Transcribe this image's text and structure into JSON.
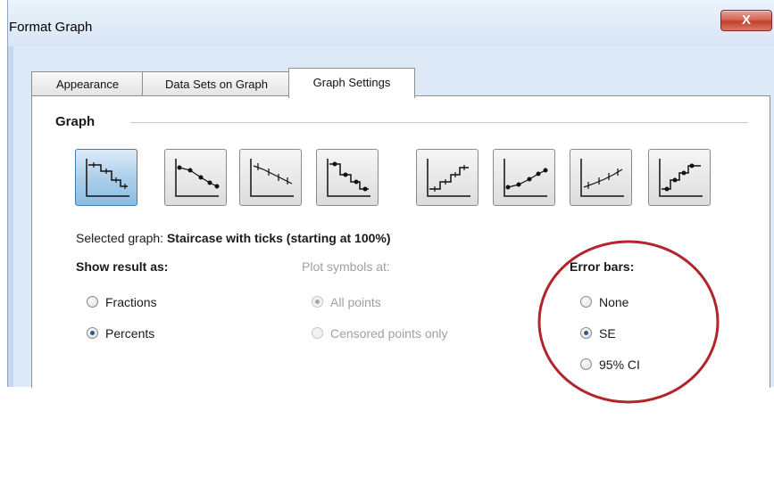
{
  "window": {
    "title": "Format Graph",
    "close_label": "X"
  },
  "tabs": [
    {
      "label": "Appearance",
      "active": false
    },
    {
      "label": "Data Sets on Graph",
      "active": false
    },
    {
      "label": "Graph Settings",
      "active": true
    }
  ],
  "graph_group": {
    "label": "Graph",
    "types": [
      {
        "name": "staircase-with-ticks",
        "selected": true
      },
      {
        "name": "points-connected-declining",
        "selected": false
      },
      {
        "name": "staircase-ticks-declining",
        "selected": false
      },
      {
        "name": "staircase-points-declining",
        "selected": false
      },
      {
        "name": "staircase-ascending",
        "selected": false
      },
      {
        "name": "points-connected-ascending",
        "selected": false
      },
      {
        "name": "staircase-ticks-ascending",
        "selected": false
      },
      {
        "name": "staircase-points-ascending",
        "selected": false
      }
    ],
    "selected_prefix": "Selected graph:",
    "selected_value": "Staircase with ticks (starting at 100%)"
  },
  "show_result": {
    "label": "Show result as:",
    "options": [
      {
        "label": "Fractions",
        "checked": false
      },
      {
        "label": "Percents",
        "checked": true
      }
    ]
  },
  "plot_symbols": {
    "label": "Plot symbols at:",
    "disabled": true,
    "options": [
      {
        "label": "All points",
        "checked": true
      },
      {
        "label": "Censored points only",
        "checked": false
      }
    ]
  },
  "error_bars": {
    "label": "Error bars:",
    "options": [
      {
        "label": "None",
        "checked": false
      },
      {
        "label": "SE",
        "checked": true
      },
      {
        "label": "95% CI",
        "checked": false
      }
    ]
  },
  "colors": {
    "accent": "#3c7fb1",
    "highlight_ring": "#b0262a",
    "window_bg": "#dde9f6"
  }
}
